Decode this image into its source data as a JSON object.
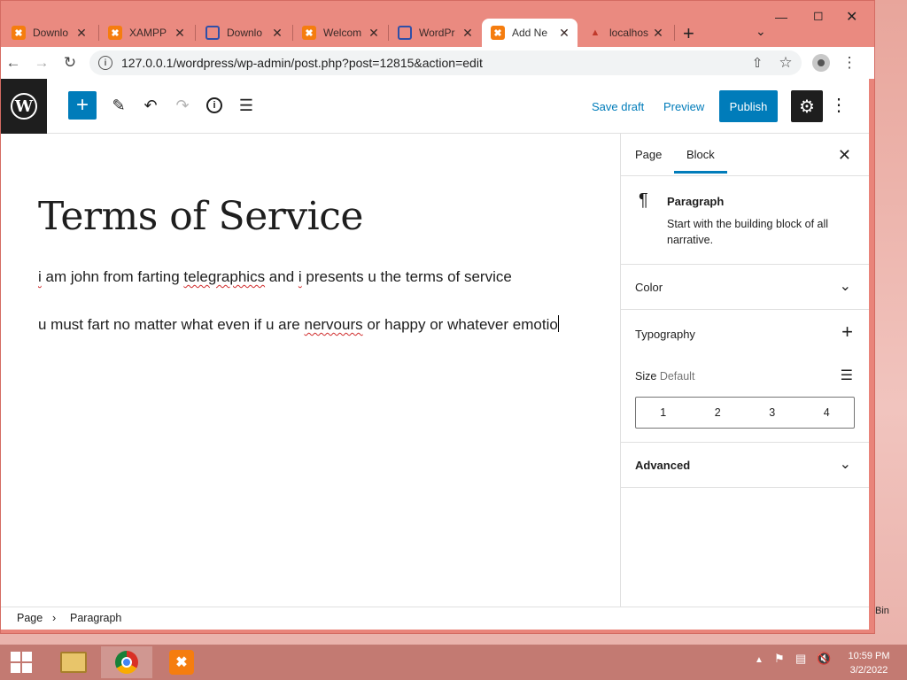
{
  "browser": {
    "tabs": [
      {
        "title": "Downlo",
        "icon": "xampp-icon"
      },
      {
        "title": "XAMPP",
        "icon": "xampp-icon"
      },
      {
        "title": "Downlo",
        "icon": "wp-hex-icon"
      },
      {
        "title": "Welcom",
        "icon": "xampp-icon"
      },
      {
        "title": "WordPr",
        "icon": "wp-hex-icon"
      },
      {
        "title": "Add Ne",
        "icon": "xampp-icon"
      },
      {
        "title": "localhos",
        "icon": "phpmyadmin-icon"
      }
    ],
    "new_tab": "+",
    "url": "127.0.0.1/wordpress/wp-admin/post.php?post=12815&action=edit"
  },
  "editor": {
    "header": {
      "save_draft": "Save draft",
      "preview": "Preview",
      "publish": "Publish"
    },
    "post_title": "Terms of Service",
    "paragraphs": {
      "p1": {
        "w1": "i",
        "w2": " am john from farting ",
        "w3": "telegraphics",
        "w4": " and ",
        "w5": "i",
        "w6": " presents u the terms of service"
      },
      "p2": {
        "w1": "u must fart no matter what even if u are ",
        "w2": "nervours",
        "w3": " or happy or whatever emotio"
      }
    },
    "sidebar": {
      "tab_page": "Page",
      "tab_block": "Block",
      "block_name": "Paragraph",
      "block_desc": "Start with the building block of all narrative.",
      "panel_color": "Color",
      "panel_typography": "Typography",
      "size_label": "Size",
      "size_default": "Default",
      "size_options": [
        "1",
        "2",
        "3",
        "4"
      ],
      "panel_advanced": "Advanced"
    },
    "breadcrumb": {
      "root": "Page",
      "current": "Paragraph"
    }
  },
  "taskbar": {
    "time": "10:59 PM",
    "date": "3/2/2022"
  },
  "desktop": {
    "recycle_bin_label": "Bin"
  },
  "colors": {
    "accent": "#007cba",
    "window_frame": "#e9847a"
  }
}
